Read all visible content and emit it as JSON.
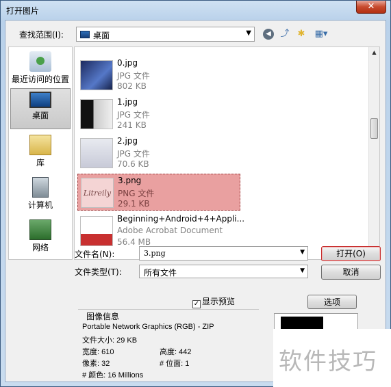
{
  "window": {
    "title": "打开图片",
    "close_glyph": "✕"
  },
  "toolbar": {
    "lookin_label": "查找范围(I):",
    "lookin_value": "桌面",
    "back_icon": "back-arrow-icon",
    "up_icon": "up-folder-icon",
    "new_folder_icon": "new-folder-icon",
    "views_icon": "views-menu-icon"
  },
  "places": [
    {
      "label": "最近访问的位置",
      "icon": "recent-places-icon"
    },
    {
      "label": "桌面",
      "icon": "desktop-icon",
      "selected": true
    },
    {
      "label": "库",
      "icon": "libraries-icon"
    },
    {
      "label": "计算机",
      "icon": "computer-icon"
    },
    {
      "label": "网络",
      "icon": "network-icon"
    }
  ],
  "files": [
    {
      "name": "0.jpg",
      "type": "JPG 文件",
      "size": "802 KB"
    },
    {
      "name": "1.jpg",
      "type": "JPG 文件",
      "size": "241 KB"
    },
    {
      "name": "2.jpg",
      "type": "JPG 文件",
      "size": "70.6 KB"
    },
    {
      "name": "3.png",
      "type": "PNG 文件",
      "size": "29.1 KB",
      "selected": true,
      "thumb_text": "Litreily"
    },
    {
      "name": "Beginning+Android+4+Appli...",
      "type": "Adobe Acrobat Document",
      "size": "56.4 MB"
    }
  ],
  "form": {
    "filename_label": "文件名(N):",
    "filename_value": "3.png",
    "filetype_label": "文件类型(T):",
    "filetype_value": "所有文件",
    "open_label": "打开(O)",
    "cancel_label": "取消",
    "options_label": "选项",
    "preview_label": "显示预览",
    "preview_checked": true,
    "check_glyph": "✓"
  },
  "image_info": {
    "title": "图像信息",
    "format": "Portable Network Graphics (RGB) - ZIP",
    "file_size": "文件大小: 29 KB",
    "width": "宽度: 610",
    "height": "高度: 442",
    "pixels": "像素: 32",
    "bit_planes": "# 位面: 1",
    "colors": "# 颜色: 16 Millions"
  },
  "watermark": {
    "text": "软件技巧"
  },
  "colors": {
    "selection": "#e9a0a0",
    "close_button": "#c74a2e",
    "open_border": "#c83030"
  }
}
